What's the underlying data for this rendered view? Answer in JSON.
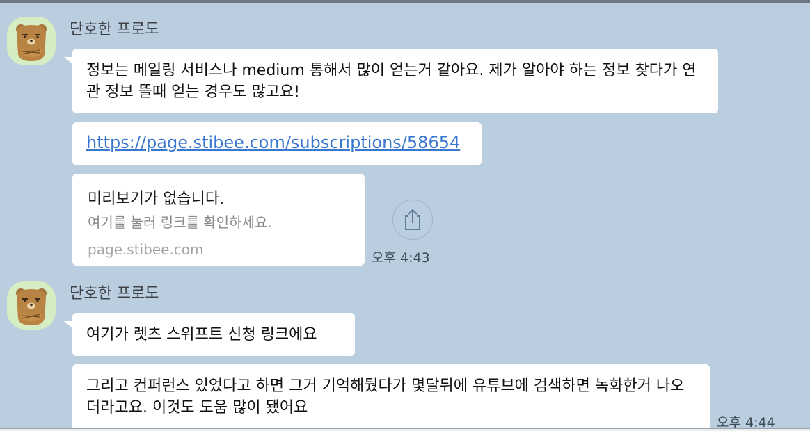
{
  "messages": [
    {
      "sender": "단호한 프로도",
      "text1": "정보는 메일링 서비스나 medium 통해서 많이 얻는거 같아요. 제가 알아야 하는 정보 찾다가 연관 정보 뜰때 얻는 경우도 많고요!",
      "link": "https://page.stibee.com/subscriptions/58654",
      "preview": {
        "title": "미리보기가 없습니다.",
        "description": "여기를 눌러 링크를 확인하세요.",
        "domain": "page.stibee.com"
      },
      "time": "오후 4:43"
    },
    {
      "sender": "단호한 프로도",
      "text1": "여기가 렛츠 스위프트 신청 링크에요",
      "text2": "그리고 컨퍼런스 있었다고 하면 그거 기억해뒀다가 몇달뒤에 유튜브에 검색하면 녹화한거 나오더라고요. 이것도 도움 많이 됐어요",
      "time": "오후 4:44"
    }
  ],
  "icons": {
    "avatar": "ryan-character-icon",
    "share": "share-icon"
  },
  "colors": {
    "background": "#bacee0",
    "bubble": "#ffffff",
    "link": "#3a78d0",
    "avatar_bg": "#d6ecc2"
  }
}
